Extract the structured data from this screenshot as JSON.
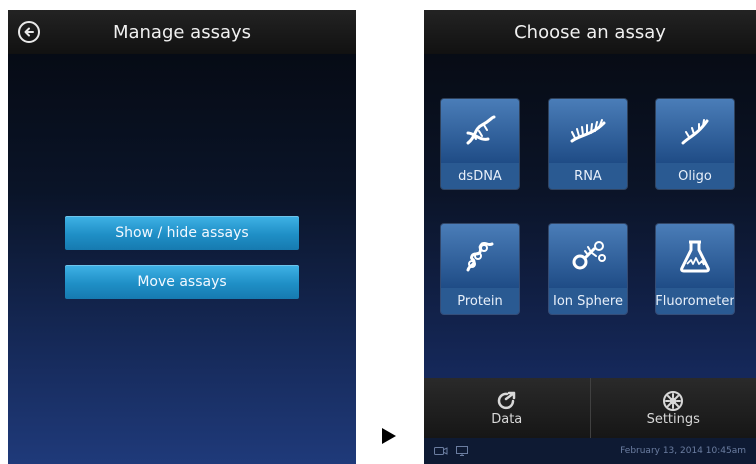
{
  "left_screen": {
    "title": "Manage assays",
    "buttons": {
      "show_hide": "Show / hide assays",
      "move": "Move assays"
    }
  },
  "right_screen": {
    "title": "Choose an assay",
    "tiles": [
      {
        "label": "dsDNA",
        "icon": "dna-double-helix-icon"
      },
      {
        "label": "RNA",
        "icon": "rna-strand-icon"
      },
      {
        "label": "Oligo",
        "icon": "oligo-strand-icon"
      },
      {
        "label": "Protein",
        "icon": "protein-coil-icon"
      },
      {
        "label": "Ion Sphere",
        "icon": "ion-sphere-icon"
      },
      {
        "label": "Fluorometer",
        "icon": "flask-icon"
      }
    ],
    "bottom_bar": {
      "data_label": "Data",
      "settings_label": "Settings"
    },
    "status": {
      "date": "February 13, 2014 10:45am"
    }
  },
  "colors": {
    "accent_button": "#2a9ad3",
    "tile": "#2f5f98"
  }
}
